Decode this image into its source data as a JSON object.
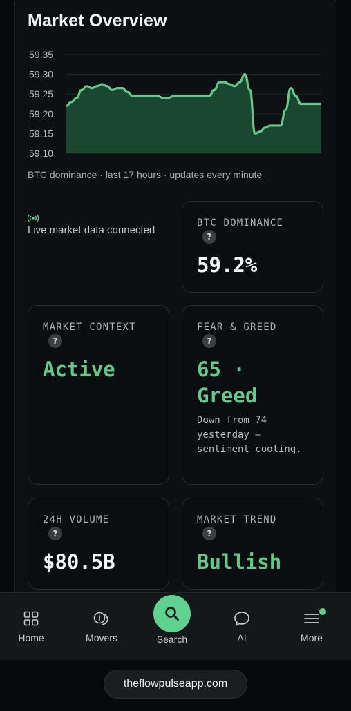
{
  "title": "Market Overview",
  "chart_data": {
    "type": "area",
    "y_ticks": [
      "59.35",
      "59.30",
      "59.25",
      "59.20",
      "59.15",
      "59.10"
    ],
    "ylim": [
      59.1,
      59.35
    ],
    "grid": true,
    "color": "#62c98a",
    "x": [
      0,
      1,
      2,
      3,
      4,
      5,
      6,
      7,
      8,
      9,
      10,
      11,
      12,
      13,
      14,
      15,
      16,
      17,
      18,
      19,
      20,
      21,
      22,
      23,
      24,
      25,
      26,
      27,
      28,
      29,
      30,
      31,
      32,
      33,
      34,
      35,
      36,
      37,
      38,
      39,
      40,
      41,
      42,
      43,
      44,
      45,
      46,
      47,
      48,
      49,
      50
    ],
    "values": [
      59.22,
      59.23,
      59.24,
      59.26,
      59.27,
      59.265,
      59.27,
      59.275,
      59.27,
      59.26,
      59.265,
      59.265,
      59.255,
      59.245,
      59.245,
      59.245,
      59.245,
      59.245,
      59.245,
      59.24,
      59.24,
      59.245,
      59.245,
      59.245,
      59.245,
      59.245,
      59.245,
      59.245,
      59.245,
      59.26,
      59.28,
      59.28,
      59.275,
      59.27,
      59.28,
      59.3,
      59.26,
      59.15,
      59.155,
      59.165,
      59.17,
      59.17,
      59.17,
      59.21,
      59.265,
      59.245,
      59.225,
      59.225,
      59.225,
      59.225,
      59.225
    ]
  },
  "caption": "BTC dominance · last 17 hours · updates every minute",
  "live": {
    "icon": "broadcast-icon",
    "text": "Live market data connected"
  },
  "cards": {
    "btc_dominance": {
      "label": "BTC DOMINANCE",
      "value": "59.2%"
    },
    "market_context": {
      "label": "MARKET CONTEXT",
      "value": "Active"
    },
    "fear_greed": {
      "label": "FEAR & GREED",
      "value_line1": "65 ·",
      "value_line2": "Greed",
      "note": "Down from 74 yesterday — sentiment cooling."
    },
    "volume": {
      "label": "24H VOLUME",
      "value": "$80.5B"
    },
    "trend": {
      "label": "MARKET TREND",
      "value": "Bullish"
    }
  },
  "help_glyph": "?",
  "nav": {
    "home": "Home",
    "movers": "Movers",
    "search": "Search",
    "ai": "AI",
    "more": "More"
  },
  "url": "theflowpulseapp.com",
  "colors": {
    "accent": "#5fd190",
    "background": "#07090a",
    "card": "#0b0e10"
  }
}
